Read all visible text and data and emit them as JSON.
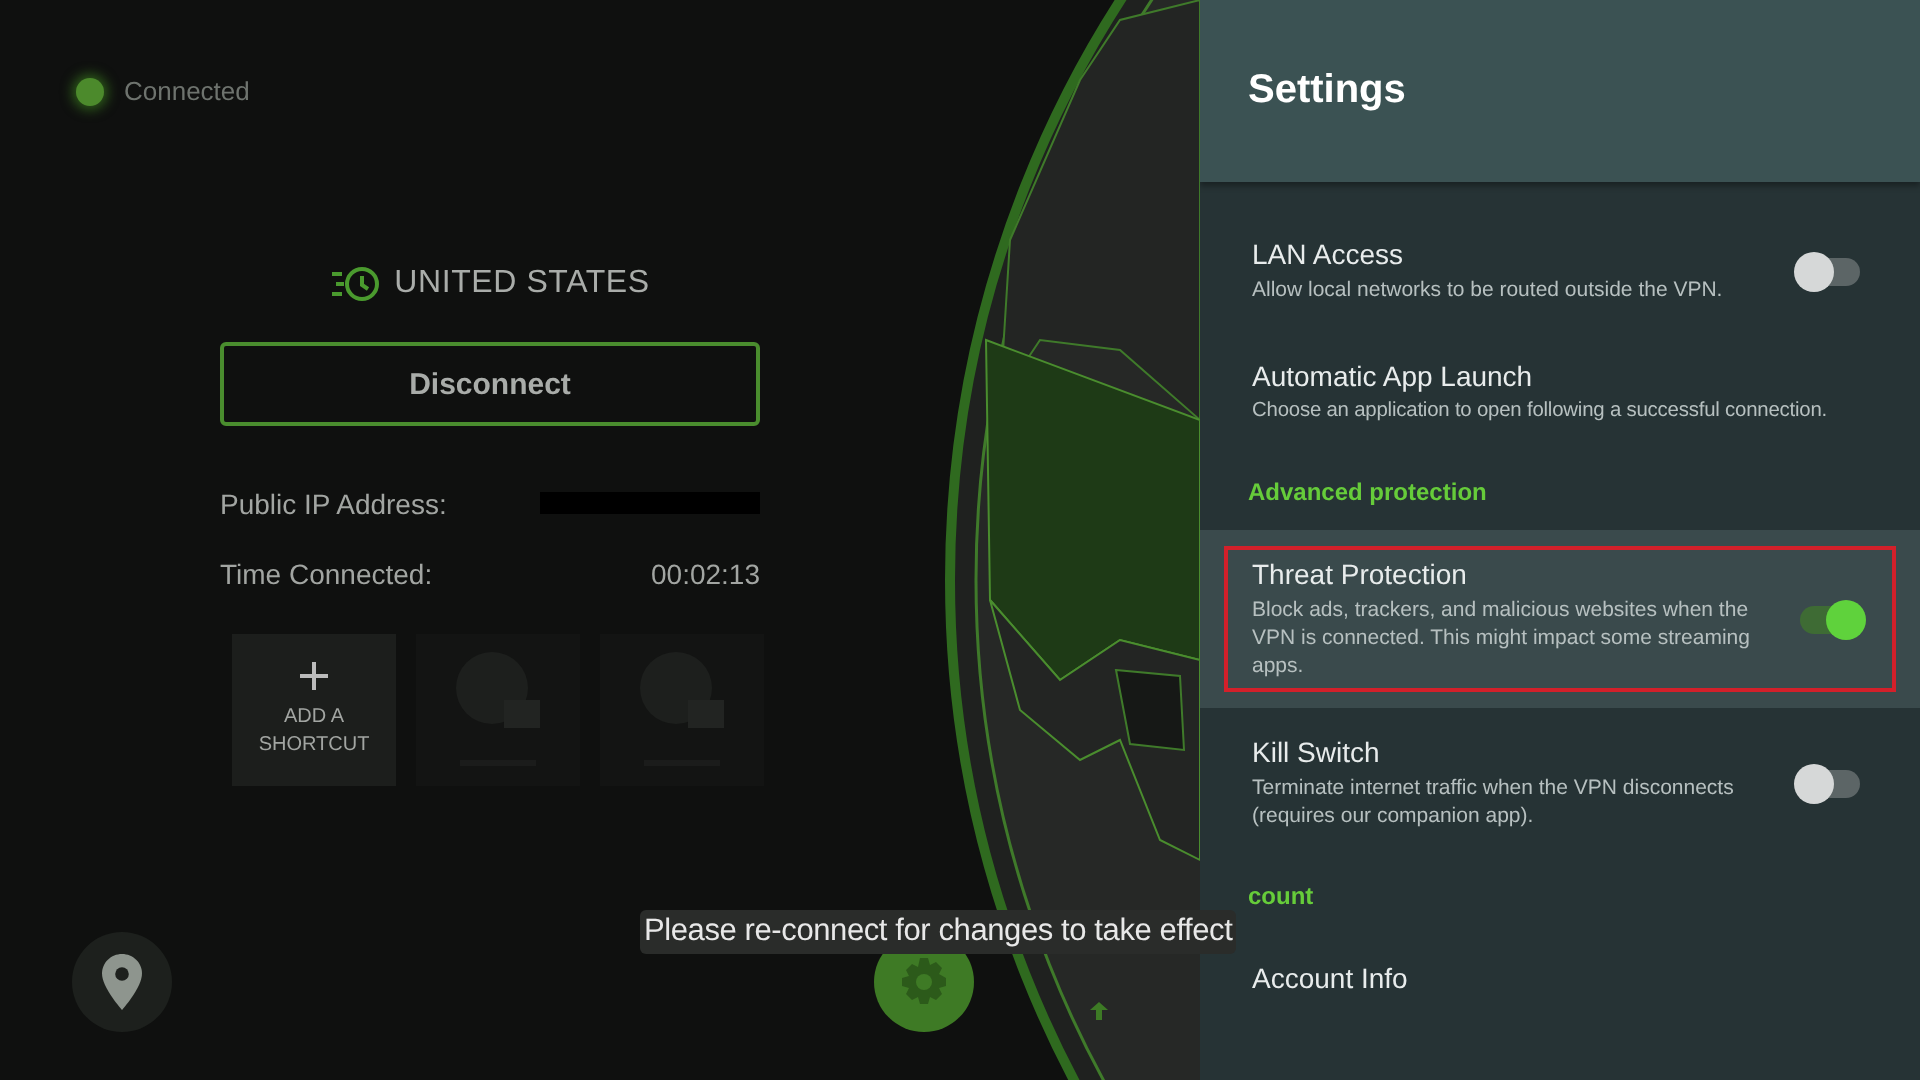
{
  "status": {
    "label": "Connected",
    "connected": true
  },
  "location": {
    "country": "UNITED STATES"
  },
  "disconnect_button": {
    "label": "Disconnect"
  },
  "info": [
    {
      "kind": "redacted",
      "label": "Public IP Address:"
    },
    {
      "kind": "text",
      "label": "Time Connected:",
      "value": "00:02:13"
    }
  ],
  "shortcuts": [
    {
      "kind": "add",
      "label": "ADD A SHORTCUT"
    },
    {
      "kind": "empty"
    },
    {
      "kind": "empty"
    }
  ],
  "settings": {
    "title": "Settings",
    "items": [
      {
        "kind": "toggle",
        "title": "LAN Access",
        "description": "Allow local networks to be routed outside the VPN.",
        "on": false,
        "selected": false,
        "highlighted": false
      },
      {
        "kind": "link",
        "title": "Automatic App Launch",
        "description": "Choose an application to open following a successful connection.",
        "selected": false,
        "highlighted": false
      },
      {
        "kind": "header",
        "title": "Advanced protection"
      },
      {
        "kind": "toggle",
        "title": "Threat Protection",
        "description": "Block ads, trackers, and malicious websites when the VPN is connected. This might impact some streaming apps.",
        "on": true,
        "selected": true,
        "highlighted": true
      },
      {
        "kind": "toggle",
        "title": "Kill Switch",
        "description": "Terminate internet traffic when the VPN disconnects (requires our companion app).",
        "on": false,
        "selected": false,
        "highlighted": false
      },
      {
        "kind": "header",
        "title": "count"
      },
      {
        "kind": "link",
        "title": "Account Info",
        "selected": false,
        "highlighted": false
      }
    ]
  },
  "toast": {
    "message": "Please re-connect for changes to take effect"
  }
}
